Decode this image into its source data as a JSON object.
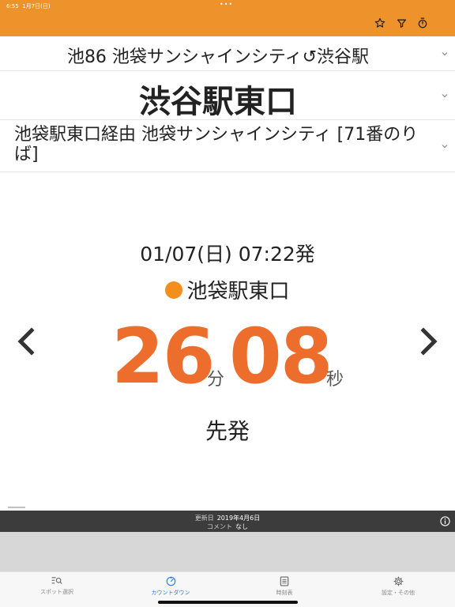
{
  "status_bar": {
    "time": "6:55",
    "date": "1月7日(日)",
    "dots": "•••"
  },
  "header": {
    "icons": [
      "star-icon",
      "filter-icon",
      "stopwatch-icon"
    ],
    "color": "#ee922c"
  },
  "route": {
    "line": "池86 池袋サンシャインシティ↺渋谷駅",
    "station": "渋谷駅東口",
    "direction": "池袋駅東口経由 池袋サンシャインシティ [71番のりば]"
  },
  "countdown": {
    "departure": "01/07(日) 07:22発",
    "stop_name": "池袋駅東口",
    "minutes": "26",
    "minutes_unit": "分",
    "seconds": "08",
    "seconds_unit": "秒",
    "label": "先発",
    "accent_color": "#ec6d2c"
  },
  "info": {
    "updated_label": "更新日",
    "updated_value": "2019年4月6日",
    "comment_label": "コメント",
    "comment_value": "なし"
  },
  "tabs": [
    {
      "label": "スポット選択",
      "icon": "spot-search-icon"
    },
    {
      "label": "カウントダウン",
      "icon": "countdown-icon"
    },
    {
      "label": "時刻表",
      "icon": "timetable-icon"
    },
    {
      "label": "設定・その他",
      "icon": "gear-icon"
    }
  ]
}
